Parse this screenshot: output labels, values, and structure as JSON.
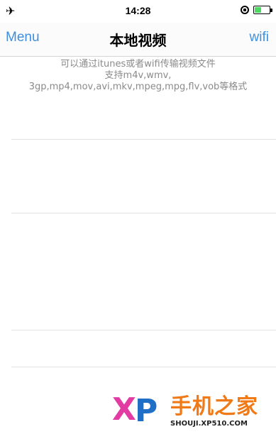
{
  "status_bar": {
    "time": "14:28",
    "airplane_icon": "airplane-icon",
    "lock_icon": "orientation-lock-icon",
    "battery_icon": "battery-icon",
    "battery_level_percent": 45,
    "battery_color": "#4cd964"
  },
  "nav": {
    "left_button": "Menu",
    "title": "本地视频",
    "right_button": "wifi",
    "accent_color": "#3e8fe0"
  },
  "content": {
    "hint_line1": "可以通过itunes或者wifi传输视频文件",
    "hint_line2": "支持m4v,wmv,",
    "hint_line3": "3gp,mp4,mov,avi,mkv,mpeg,mpg,flv,vob等格式"
  },
  "watermark": {
    "x": "X",
    "p": "P",
    "brand": "手机之家",
    "domain": "SHOUJI.XP510.COM"
  }
}
